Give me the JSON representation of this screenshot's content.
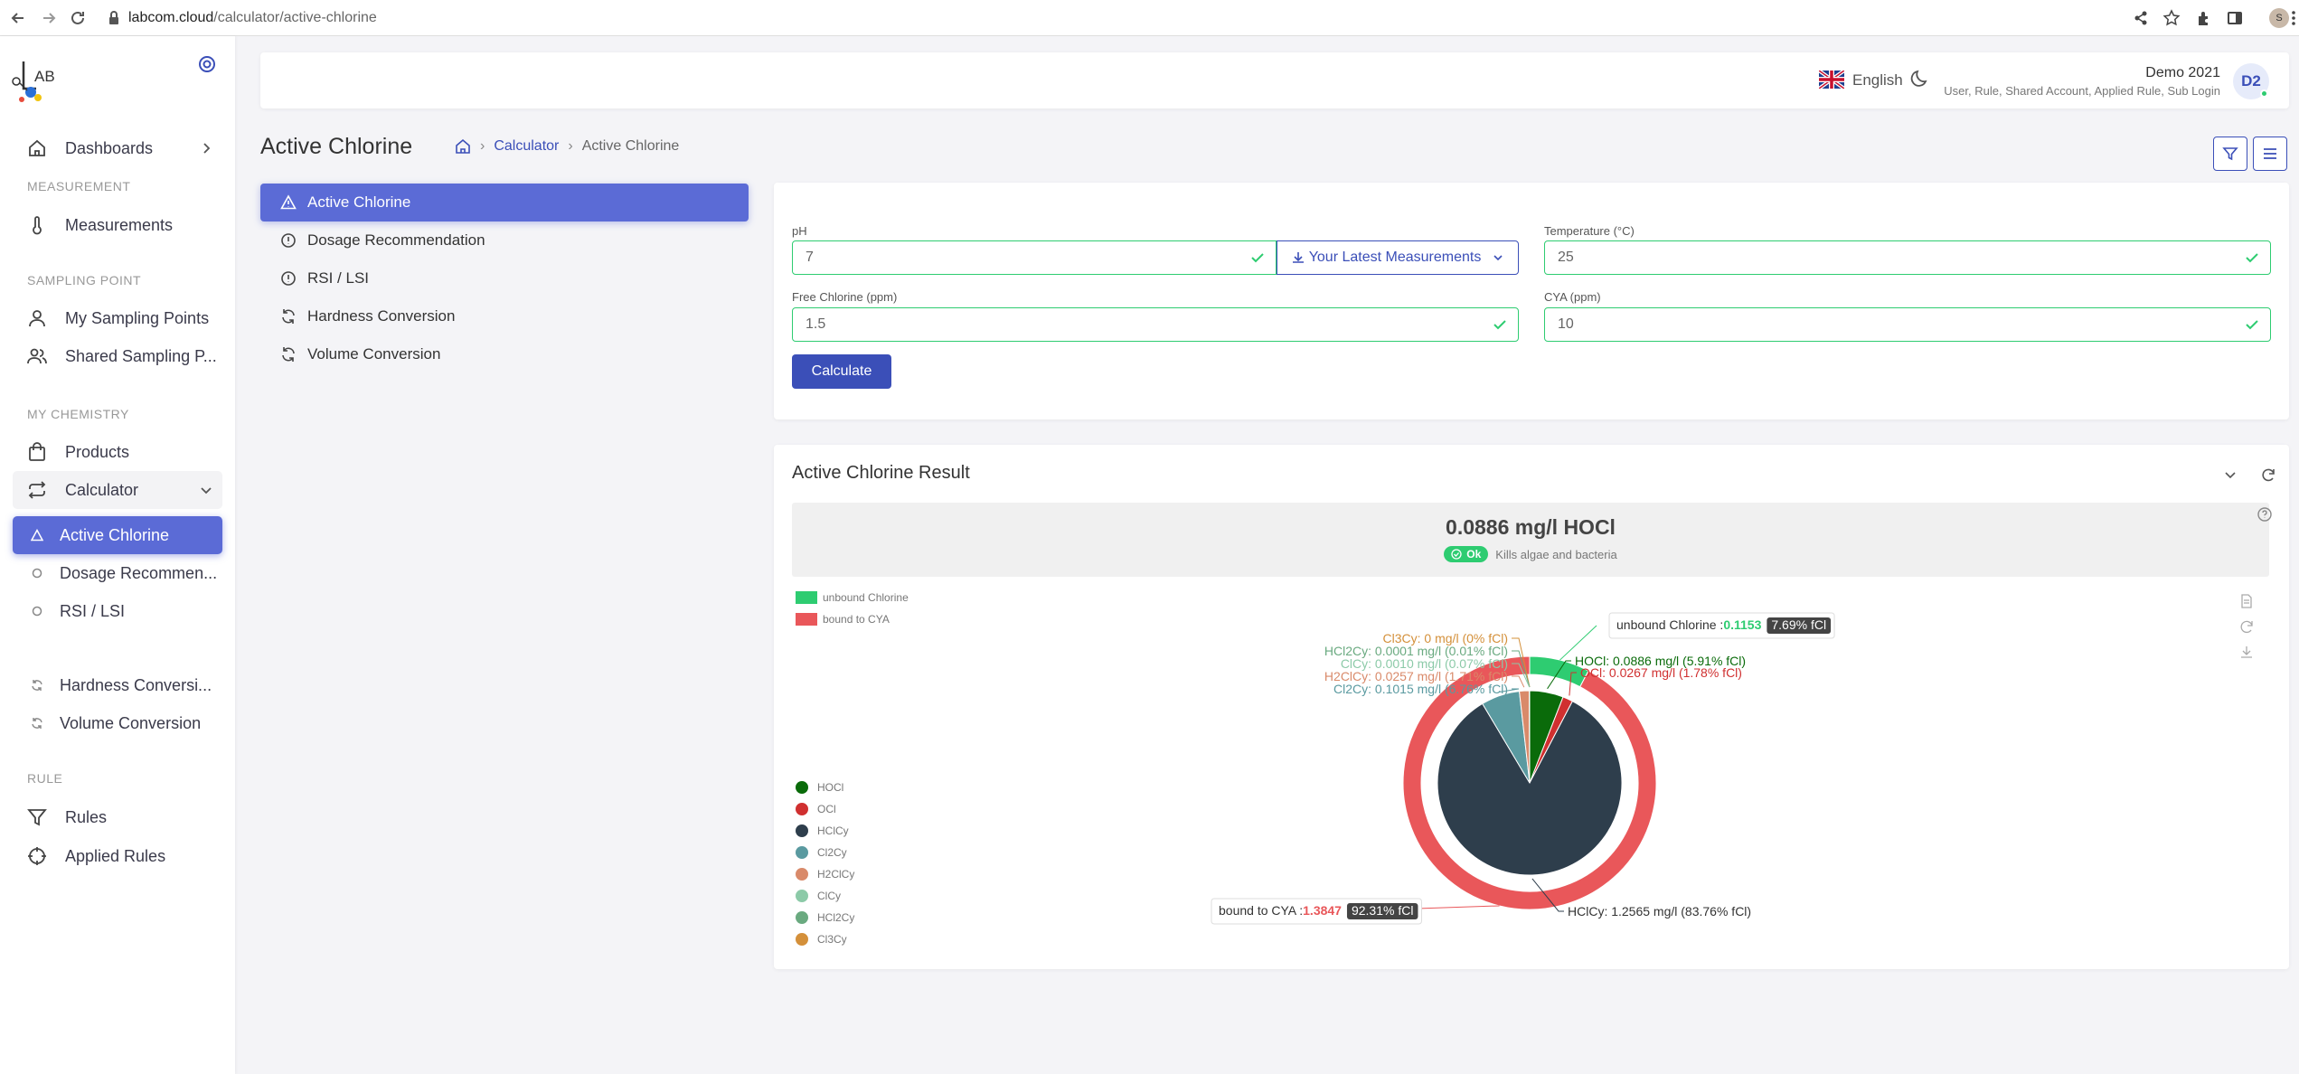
{
  "browser": {
    "url_host": "labcom.cloud",
    "url_path": "/calculator/active-chlorine",
    "profile_initial": "S"
  },
  "sidebar": {
    "logo_text": "AB",
    "dashboards": "Dashboards",
    "sections": {
      "measurement": "MEASUREMENT",
      "sampling_point": "SAMPLING POINT",
      "my_chemistry": "MY CHEMISTRY",
      "rule": "RULE"
    },
    "measurements": "Measurements",
    "my_sampling_points": "My Sampling Points",
    "shared_sampling_points": "Shared Sampling P...",
    "products": "Products",
    "calculator": "Calculator",
    "calc_items": [
      "Active Chlorine",
      "Dosage Recommen...",
      "RSI / LSI",
      "Hardness Conversi...",
      "Volume Conversion"
    ],
    "rules": "Rules",
    "applied_rules": "Applied Rules"
  },
  "header": {
    "language": "English",
    "user_name": "Demo 2021",
    "user_roles": "User, Rule, Shared Account, Applied Rule, Sub Login",
    "avatar": "D2"
  },
  "page": {
    "title": "Active Chlorine",
    "breadcrumb": [
      "Calculator",
      "Active Chlorine"
    ]
  },
  "calc_nav": [
    "Active Chlorine",
    "Dosage Recommendation",
    "RSI / LSI",
    "Hardness Conversion",
    "Volume Conversion"
  ],
  "form": {
    "ph_label": "pH",
    "ph_value": "7",
    "latest_button": "Your Latest Measurements",
    "temp_label": "Temperature (°C)",
    "temp_value": "25",
    "free_cl_label": "Free Chlorine (ppm)",
    "free_cl_value": "1.5",
    "cya_label": "CYA (ppm)",
    "cya_value": "10",
    "calculate": "Calculate"
  },
  "result": {
    "title": "Active Chlorine Result",
    "summary_value": "0.0886 mg/l HOCl",
    "status": "Ok",
    "status_desc": "Kills algae and bacteria"
  },
  "colors": {
    "unbound": "#2ecc71",
    "bound": "#e9575a",
    "HOCl": "#0a6b0a",
    "OCl": "#d03030",
    "HClCy": "#2e3e4c",
    "Cl2Cy": "#5a9aa0",
    "H2ClCy": "#d98a6a",
    "ClCy": "#8ccaa8",
    "HCl2Cy": "#6aaa80",
    "Cl3Cy": "#d4903a",
    "accent": "#3b4fb8"
  },
  "chart_data": {
    "type": "pie",
    "outer_legend": [
      "unbound Chlorine",
      "bound to CYA"
    ],
    "outer": [
      {
        "name": "unbound Chlorine",
        "value": 0.1153,
        "percent_label": "7.69% fCl"
      },
      {
        "name": "bound to CYA",
        "value": 1.3847,
        "percent_label": "92.31% fCl"
      }
    ],
    "inner": [
      {
        "name": "HOCl",
        "value": 0.0886,
        "label": "HOCl: 0.0886 mg/l (5.91% fCl)"
      },
      {
        "name": "OCl",
        "value": 0.0267,
        "label": "OCl: 0.0267 mg/l (1.78% fCl)"
      },
      {
        "name": "HClCy",
        "value": 1.2565,
        "label": "HClCy: 1.2565 mg/l (83.76% fCl)"
      },
      {
        "name": "Cl2Cy",
        "value": 0.1015,
        "label": "Cl2Cy: 0.1015 mg/l (6.76% fCl)"
      },
      {
        "name": "H2ClCy",
        "value": 0.0257,
        "label": "H2ClCy: 0.0257 mg/l (1.71% fCl)"
      },
      {
        "name": "ClCy",
        "value": 0.001,
        "label": "ClCy: 0.0010 mg/l (0.07% fCl)"
      },
      {
        "name": "HCl2Cy",
        "value": 0.0001,
        "label": "HCl2Cy: 0.0001 mg/l (0.01% fCl)"
      },
      {
        "name": "Cl3Cy",
        "value": 0,
        "label": "Cl3Cy: 0 mg/l (0% fCl)"
      }
    ]
  }
}
